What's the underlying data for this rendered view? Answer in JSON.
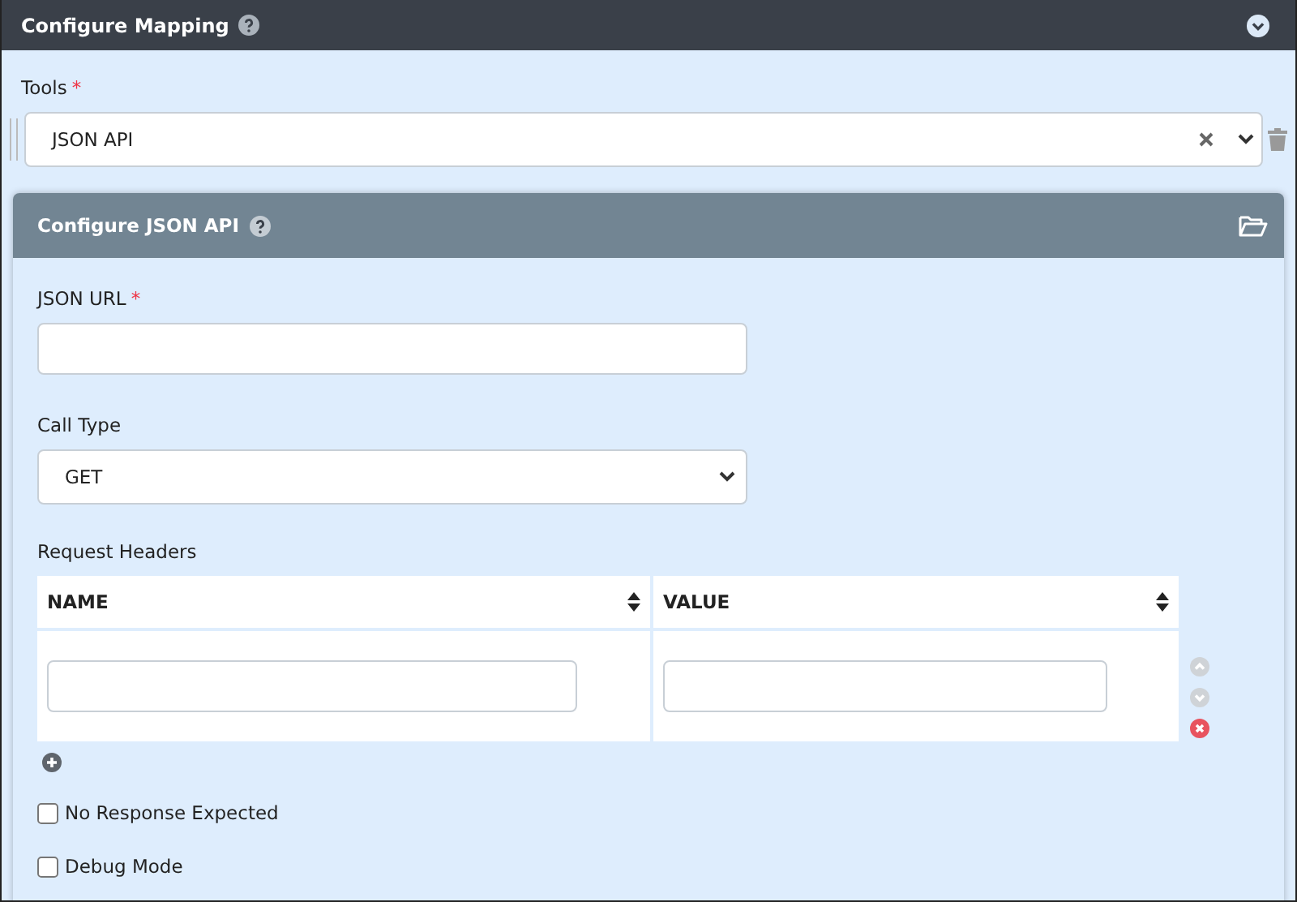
{
  "section": {
    "title": "Configure Mapping",
    "expanded": true
  },
  "tools": {
    "label": "Tools",
    "required_mark": "*",
    "value": "JSON API"
  },
  "panel": {
    "title": "Configure JSON API",
    "json_url": {
      "label": "JSON URL",
      "required_mark": "*"
    },
    "call_type": {
      "label": "Call Type",
      "value": "GET"
    },
    "request_headers": {
      "label": "Request Headers",
      "columns": [
        {
          "label": "NAME"
        },
        {
          "label": "VALUE"
        }
      ],
      "rows": [
        {
          "kind": "input-row"
        }
      ]
    },
    "options": [
      {
        "label": "No Response Expected",
        "checked": false
      },
      {
        "label": "Debug Mode",
        "checked": false
      }
    ]
  }
}
